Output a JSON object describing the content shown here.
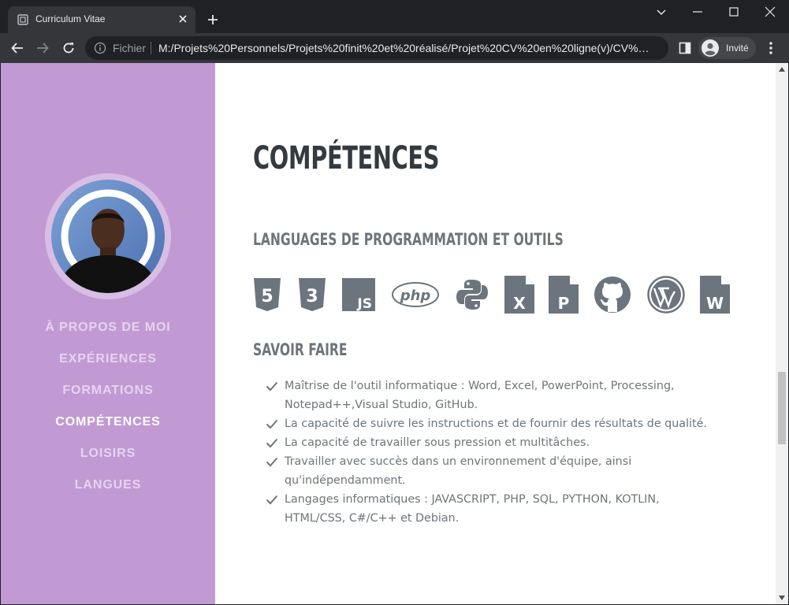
{
  "browser": {
    "tab_title": "Curriculum Vitae",
    "url_scheme": "Fichier",
    "url": "M:/Projets%20Personnels/Projets%20finit%20et%20réalisé/Projet%20CV%20en%20ligne(v)/CV%20e...",
    "profile_label": "Invité"
  },
  "sidebar": {
    "nav": [
      {
        "label": "À PROPOS DE MOI",
        "active": false
      },
      {
        "label": "EXPÉRIENCES",
        "active": false
      },
      {
        "label": "FORMATIONS",
        "active": false
      },
      {
        "label": "COMPÉTENCES",
        "active": true
      },
      {
        "label": "LOISIRS",
        "active": false
      },
      {
        "label": "LANGUES",
        "active": false
      }
    ]
  },
  "section": {
    "title": "COMPÉTENCES",
    "tools_heading": "LANGUAGES DE PROGRAMMATION ET OUTILS",
    "tools": [
      {
        "icon": "html5-icon",
        "text": "5"
      },
      {
        "icon": "css3-icon",
        "text": "3"
      },
      {
        "icon": "javascript-icon",
        "text": "JS"
      },
      {
        "icon": "php-icon",
        "text": "php"
      },
      {
        "icon": "python-icon"
      },
      {
        "icon": "excel-file-icon",
        "text": "X"
      },
      {
        "icon": "powerpoint-file-icon",
        "text": "P"
      },
      {
        "icon": "github-icon"
      },
      {
        "icon": "wordpress-icon"
      },
      {
        "icon": "word-file-icon",
        "text": "W"
      }
    ],
    "skills_heading": "SAVOIR FAIRE",
    "skills": [
      "Maîtrise de l'outil informatique : Word, Excel, PowerPoint, Processing, Notepad++,Visual Studio, GitHub.",
      "La capacité de suivre les instructions et de fournir des résultats de qualité.",
      "La capacité de travailler sous pression et multitâches.",
      "Travailler avec succès dans un environnement d'équipe, ainsi qu'indépendamment.",
      "Langages informatiques : JAVASCRIPT, PHP, SQL, PYTHON, KOTLIN, HTML/CSS, C#/C++ et Debian."
    ]
  },
  "colors": {
    "sidebar_bg": "#c19ad4",
    "heading": "#343a40",
    "body_text": "#6c757d",
    "icon": "#6c757d"
  }
}
